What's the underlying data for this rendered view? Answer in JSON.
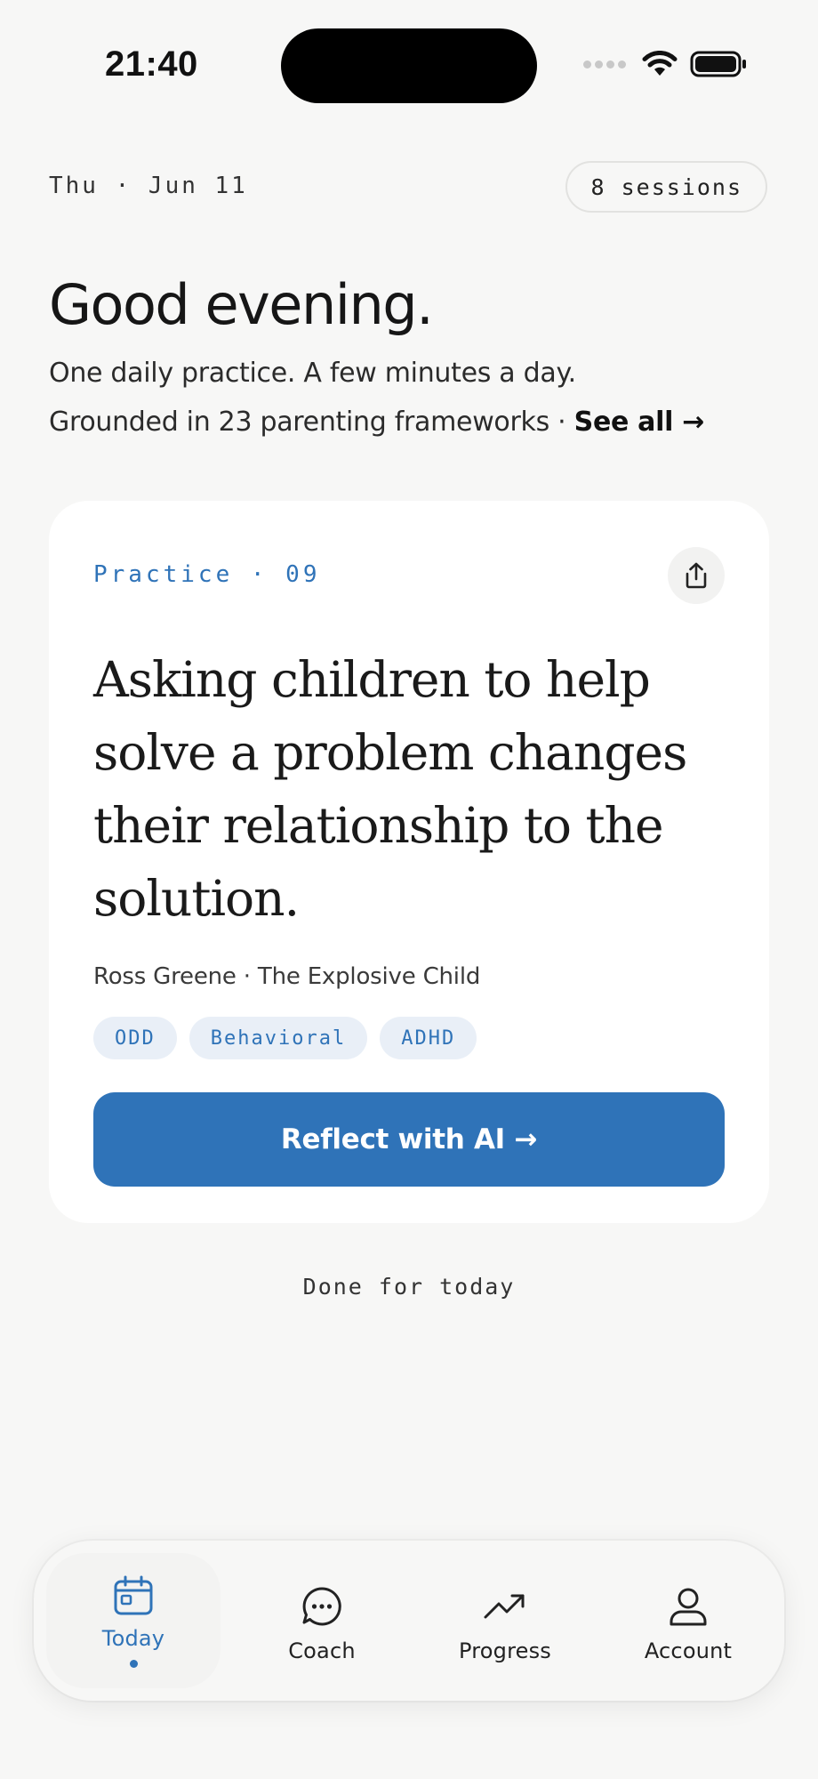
{
  "status_bar": {
    "time": "21:40"
  },
  "header": {
    "date": "Thu · Jun 11",
    "sessions": "8 sessions"
  },
  "greeting": {
    "title": "Good evening.",
    "subtitle": "One daily practice. A few minutes a day.",
    "frameworks_text": "Grounded in 23 parenting frameworks · ",
    "see_all": "See all →"
  },
  "card": {
    "practice_label": "Practice · 09",
    "quote": "Asking children to help solve a problem changes their relationship to the solution.",
    "attribution": "Ross Greene · The Explosive Child",
    "tags": [
      "ODD",
      "Behavioral",
      "ADHD"
    ],
    "cta": "Reflect with AI →"
  },
  "done_text": "Done for today",
  "tabbar": {
    "items": [
      {
        "label": "Today",
        "icon": "calendar-icon",
        "active": true
      },
      {
        "label": "Coach",
        "icon": "chat-bubble-icon",
        "active": false
      },
      {
        "label": "Progress",
        "icon": "trend-up-icon",
        "active": false
      },
      {
        "label": "Account",
        "icon": "person-icon",
        "active": false
      }
    ]
  },
  "colors": {
    "accent": "#2f73b8",
    "background": "#f7f7f6",
    "card": "#ffffff",
    "tag_background": "#e9eff7"
  }
}
